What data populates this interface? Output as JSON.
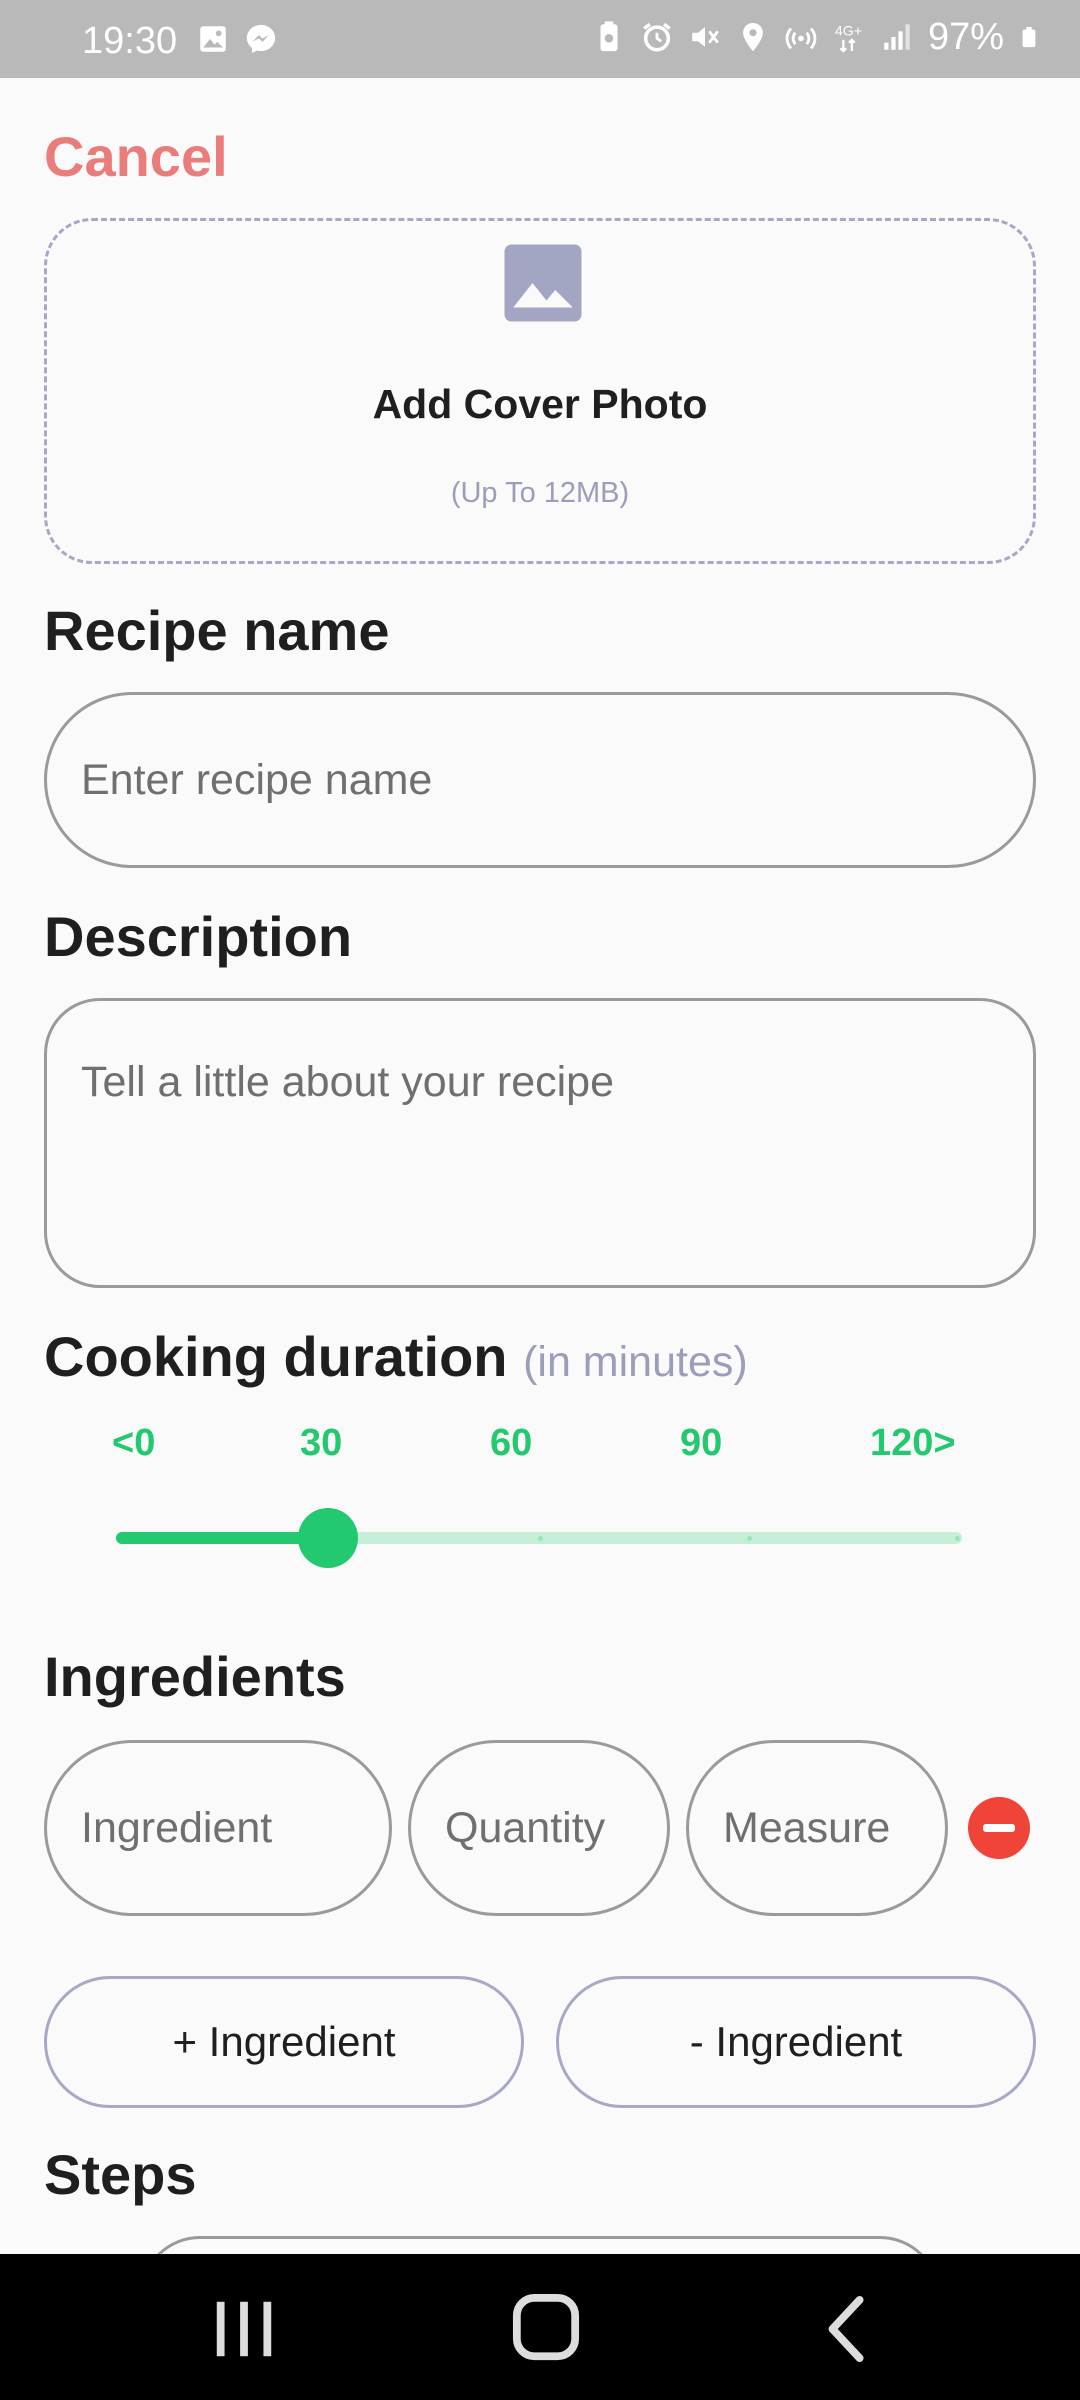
{
  "status_bar": {
    "time": "19:30",
    "battery": "97%",
    "left_icons": [
      "image-icon",
      "messenger-icon"
    ],
    "right_icons": [
      "battery-saver-icon",
      "alarm-icon",
      "mute-icon",
      "location-icon",
      "hotspot-icon",
      "4g-icon",
      "signal-icon",
      "battery-icon"
    ]
  },
  "header": {
    "cancel_label": "Cancel",
    "cancel_color": "#ea7c7c"
  },
  "cover": {
    "title": "Add Cover Photo",
    "subtitle": "(Up To 12MB)",
    "icon": "image-icon"
  },
  "recipe_name": {
    "label": "Recipe name",
    "placeholder": "Enter recipe name",
    "value": ""
  },
  "description": {
    "label": "Description",
    "placeholder": "Tell a little about your recipe",
    "value": ""
  },
  "cooking_duration": {
    "label": "Cooking duration",
    "note": "(in minutes)",
    "ticks": [
      "<0",
      "30",
      "60",
      "90",
      "120>"
    ],
    "value": 30,
    "min": 0,
    "max": 120,
    "accent": "#22c96e"
  },
  "ingredients": {
    "label": "Ingredients",
    "row": {
      "ingredient_placeholder": "Ingredient",
      "quantity_placeholder": "Quantity",
      "measure_placeholder": "Measure"
    },
    "add_label": "+ Ingredient",
    "remove_label": "- Ingredient"
  },
  "steps": {
    "label": "Steps"
  },
  "nav": [
    "recent-apps-icon",
    "home-icon",
    "back-icon"
  ]
}
